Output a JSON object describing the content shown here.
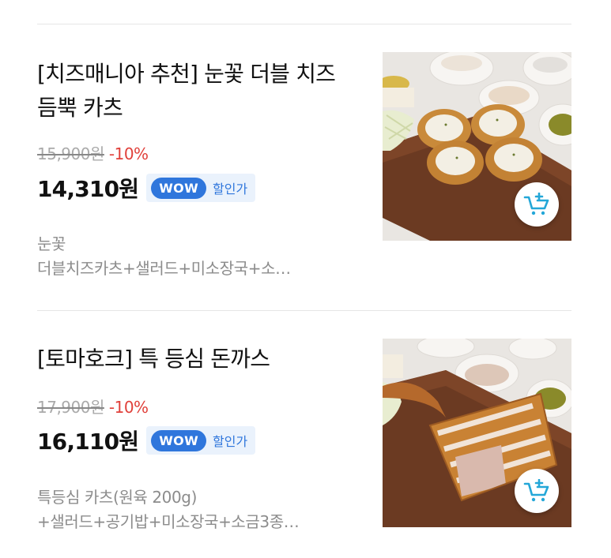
{
  "products": [
    {
      "title": "[치즈매니아 추천] 눈꽃 더블 치즈 듬뿍 카츠",
      "original_price": "15,900원",
      "discount": "-10%",
      "sale_price": "14,310원",
      "wow_label": "WOW",
      "wow_text": "할인가",
      "desc_line1": "눈꽃",
      "desc_line2": "더블치즈카츠+샐러드+미소장국+소…",
      "image_icon": "cheese-katsu-photo",
      "cart_icon": "add-to-cart-icon"
    },
    {
      "title": "[토마호크] 특 등심 돈까스",
      "original_price": "17,900원",
      "discount": "-10%",
      "sale_price": "16,110원",
      "wow_label": "WOW",
      "wow_text": "할인가",
      "desc_line1": "특등심 카츠(원육 200g)",
      "desc_line2": "+샐러드+공기밥+미소장국+소금3종…",
      "image_icon": "tomahawk-katsu-photo",
      "cart_icon": "add-to-cart-icon"
    }
  ],
  "colors": {
    "wow_blue": "#2f76dc",
    "wow_bg": "#eaf2fc",
    "discount_red": "#e0403a",
    "cart_teal": "#24a7d8"
  }
}
